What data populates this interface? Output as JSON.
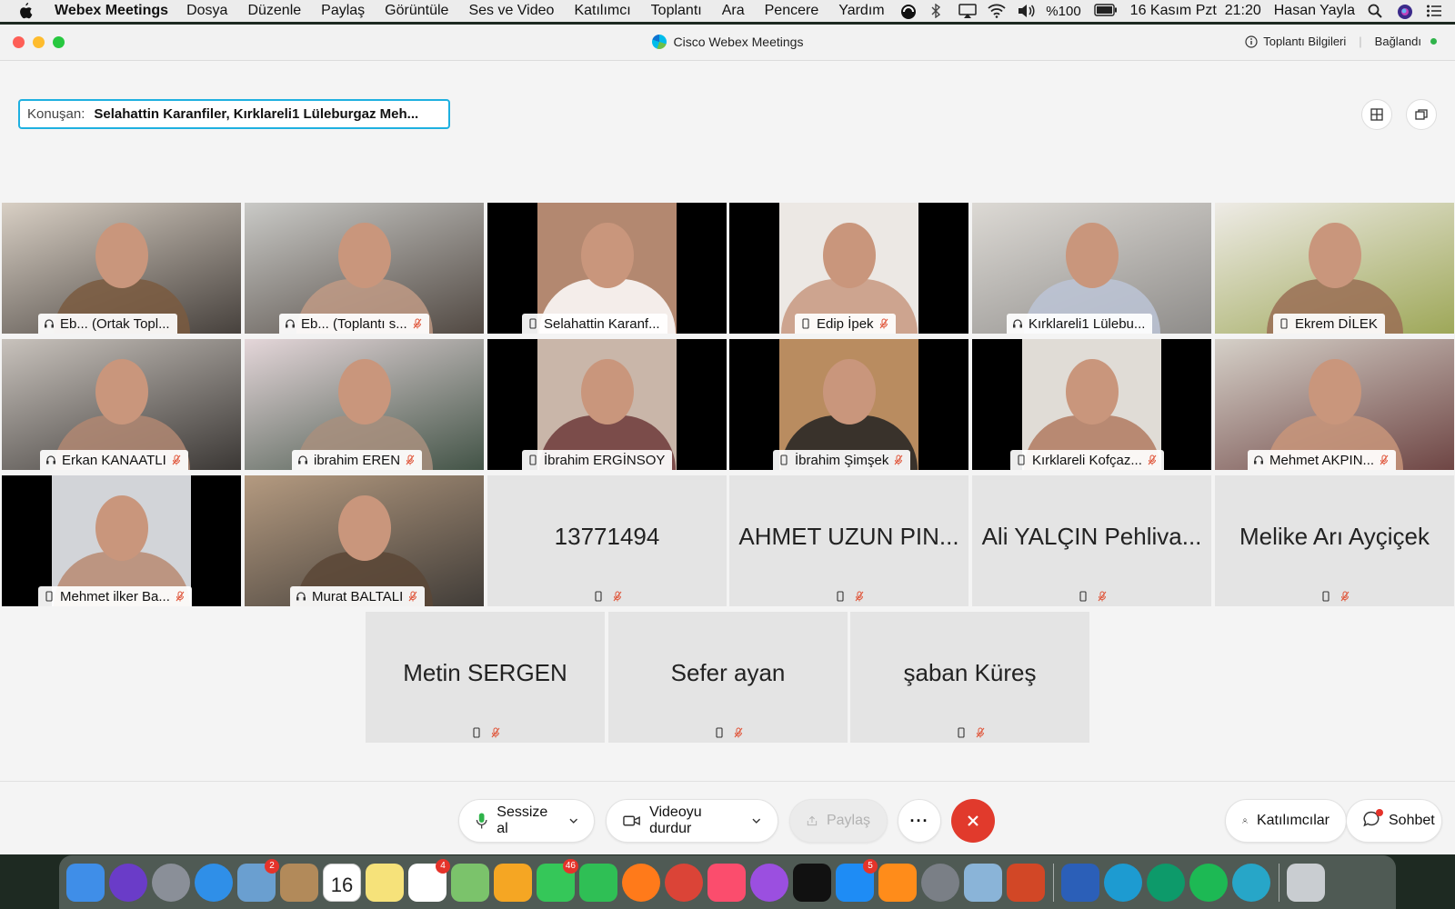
{
  "menubar": {
    "app_name": "Webex Meetings",
    "items": [
      "Dosya",
      "Düzenle",
      "Paylaş",
      "Görüntüle",
      "Ses ve Video",
      "Katılımcı",
      "Toplantı",
      "Ara",
      "Pencere",
      "Yardım"
    ],
    "battery": "%100",
    "datetime": "16 Kasım Pzt  21:20",
    "user": "Hasan Yayla"
  },
  "window": {
    "title": "Cisco Webex Meetings",
    "meeting_info": "Toplantı Bilgileri",
    "status": "Bağlandı",
    "speaker_label": "Konuşan:",
    "speaker_value": "Selahattin Karanfiler,    Kırklareli1 Lüleburgaz Meh..."
  },
  "participants": [
    {
      "name": "Eb...  (Ortak Topl...",
      "device": "headset",
      "muted": false,
      "video": true,
      "active": false,
      "colors": [
        "#d8cfc4",
        "#2a2522",
        "#7a5a40"
      ]
    },
    {
      "name": "Eb...  (Toplantı s...",
      "device": "headset",
      "muted": true,
      "video": true,
      "active": false,
      "colors": [
        "#c9c9c6",
        "#3a3029",
        "#c09a85"
      ]
    },
    {
      "name": "Selahattin Karanf...",
      "device": "phone",
      "muted": false,
      "video": true,
      "active": true,
      "colors": [
        "#b38870",
        "#000000",
        "#ffffff"
      ]
    },
    {
      "name": "Edip İpek",
      "device": "phone",
      "muted": true,
      "video": true,
      "active": false,
      "colors": [
        "#ece8e4",
        "#000000",
        "#c89880"
      ]
    },
    {
      "name": "Kırklareli1 Lülebu...",
      "device": "headset",
      "muted": false,
      "video": true,
      "active": true,
      "colors": [
        "#dcd9d4",
        "#7f7d7b",
        "#bcc4d6"
      ]
    },
    {
      "name": "Ekrem DİLEK",
      "device": "phone",
      "muted": false,
      "video": true,
      "active": false,
      "colors": [
        "#eeebe6",
        "#8e9a3c",
        "#9a6f55"
      ]
    },
    {
      "name": "Erkan KANAATLI",
      "device": "headset",
      "muted": true,
      "video": true,
      "active": false,
      "colors": [
        "#c8c2bc",
        "#1f1c1a",
        "#b08772"
      ]
    },
    {
      "name": "ibrahim EREN",
      "device": "headset",
      "muted": true,
      "video": true,
      "active": false,
      "colors": [
        "#e4d6d9",
        "#233a2a",
        "#a88f7e"
      ]
    },
    {
      "name": "İbrahim ERGİNSOY",
      "device": "phone",
      "muted": false,
      "video": true,
      "active": false,
      "colors": [
        "#c9b6a9",
        "#000000",
        "#6d3a3a"
      ]
    },
    {
      "name": "İbrahim Şimşek",
      "device": "phone",
      "muted": true,
      "video": true,
      "active": false,
      "colors": [
        "#b98c60",
        "#000000",
        "#222222"
      ]
    },
    {
      "name": "Kırklareli Kofçaz...",
      "device": "phone",
      "muted": true,
      "video": true,
      "active": false,
      "colors": [
        "#e0dcd6",
        "#000000",
        "#b07a60"
      ]
    },
    {
      "name": "Mehmet AKPIN...",
      "device": "headset",
      "muted": true,
      "video": true,
      "active": false,
      "colors": [
        "#d5d0c8",
        "#5a2a2a",
        "#c8957a"
      ]
    },
    {
      "name": "Mehmet ilker Ba...",
      "device": "phone",
      "muted": true,
      "video": true,
      "active": false,
      "colors": [
        "#d2d4d8",
        "#000000",
        "#b98a72"
      ]
    },
    {
      "name": "Murat BALTALI",
      "device": "headset",
      "muted": true,
      "video": true,
      "active": false,
      "colors": [
        "#b49a80",
        "#2a2a2a",
        "#5a4636"
      ]
    },
    {
      "name": "13771494",
      "device": "phone",
      "muted": true,
      "video": false,
      "active": false
    },
    {
      "name": "AHMET UZUN PIN...",
      "device": "phone",
      "muted": true,
      "video": false,
      "active": false
    },
    {
      "name": "Ali YALÇIN Pehliva...",
      "device": "phone",
      "muted": true,
      "video": false,
      "active": false
    },
    {
      "name": "Melike Arı Ayçiçek",
      "device": "phone",
      "muted": true,
      "video": false,
      "active": false
    },
    {
      "name": "Metin SERGEN",
      "device": "phone",
      "muted": true,
      "video": false,
      "active": false
    },
    {
      "name": "Sefer ayan",
      "device": "phone",
      "muted": true,
      "video": false,
      "active": false
    },
    {
      "name": "şaban Küreş",
      "device": "phone",
      "muted": true,
      "video": false,
      "active": false
    }
  ],
  "toolbar": {
    "mute_label": "Sessize al",
    "video_label": "Videoyu durdur",
    "share_label": "Paylaş",
    "more_label": "···",
    "participants_label": "Katılımcılar",
    "chat_label": "Sohbet"
  },
  "colors": {
    "accent": "#1eb0e0",
    "end_call": "#e13a2c",
    "mute_icon": "#2fb34a",
    "muted_mic": "#e0573c"
  },
  "dock": {
    "apps": [
      {
        "icon": "finder-icon",
        "color": "#3f8ee8"
      },
      {
        "icon": "siri-icon",
        "color": "#6a3cc8"
      },
      {
        "icon": "launchpad-icon",
        "color": "#8a8f98"
      },
      {
        "icon": "safari-icon",
        "color": "#2f8fe8"
      },
      {
        "icon": "mail-stamp-icon",
        "color": "#6a9fd0",
        "badge": "2"
      },
      {
        "icon": "contacts-icon",
        "color": "#b28a5a"
      },
      {
        "icon": "calendar-icon",
        "color": "#ffffff",
        "text": "16"
      },
      {
        "icon": "notes-icon",
        "color": "#f6e27a"
      },
      {
        "icon": "reminders-icon",
        "color": "#ffffff",
        "badge": "4"
      },
      {
        "icon": "maps-icon",
        "color": "#7bc36b"
      },
      {
        "icon": "photos-icon",
        "color": "#f5a623"
      },
      {
        "icon": "messages-icon",
        "color": "#35c759",
        "badge": "46"
      },
      {
        "icon": "facetime-icon",
        "color": "#2fbf55"
      },
      {
        "icon": "firefox-icon",
        "color": "#ff7a1a"
      },
      {
        "icon": "chrome-icon",
        "color": "#db4437"
      },
      {
        "icon": "music-icon",
        "color": "#fb4d6d"
      },
      {
        "icon": "podcasts-icon",
        "color": "#9b4fe0"
      },
      {
        "icon": "appletv-icon",
        "color": "#111111"
      },
      {
        "icon": "appstore-icon",
        "color": "#1e8cf5",
        "badge": "5"
      },
      {
        "icon": "books-icon",
        "color": "#ff8c1a"
      },
      {
        "icon": "system-preferences-icon",
        "color": "#7a7f86"
      },
      {
        "icon": "preview-icon",
        "color": "#8ab4d8"
      },
      {
        "icon": "powerpoint-icon",
        "color": "#d24726"
      },
      {
        "icon": "word-icon",
        "color": "#2b5fb8"
      },
      {
        "icon": "fb-icon",
        "color": "#1d9bd1"
      },
      {
        "icon": "webex-meetings-icon",
        "color": "#0d9a6a"
      },
      {
        "icon": "spotify-icon",
        "color": "#1db954"
      },
      {
        "icon": "webex-icon",
        "color": "#27a6c8"
      },
      {
        "icon": "trash-icon",
        "color": "#c9cdd1"
      }
    ]
  }
}
